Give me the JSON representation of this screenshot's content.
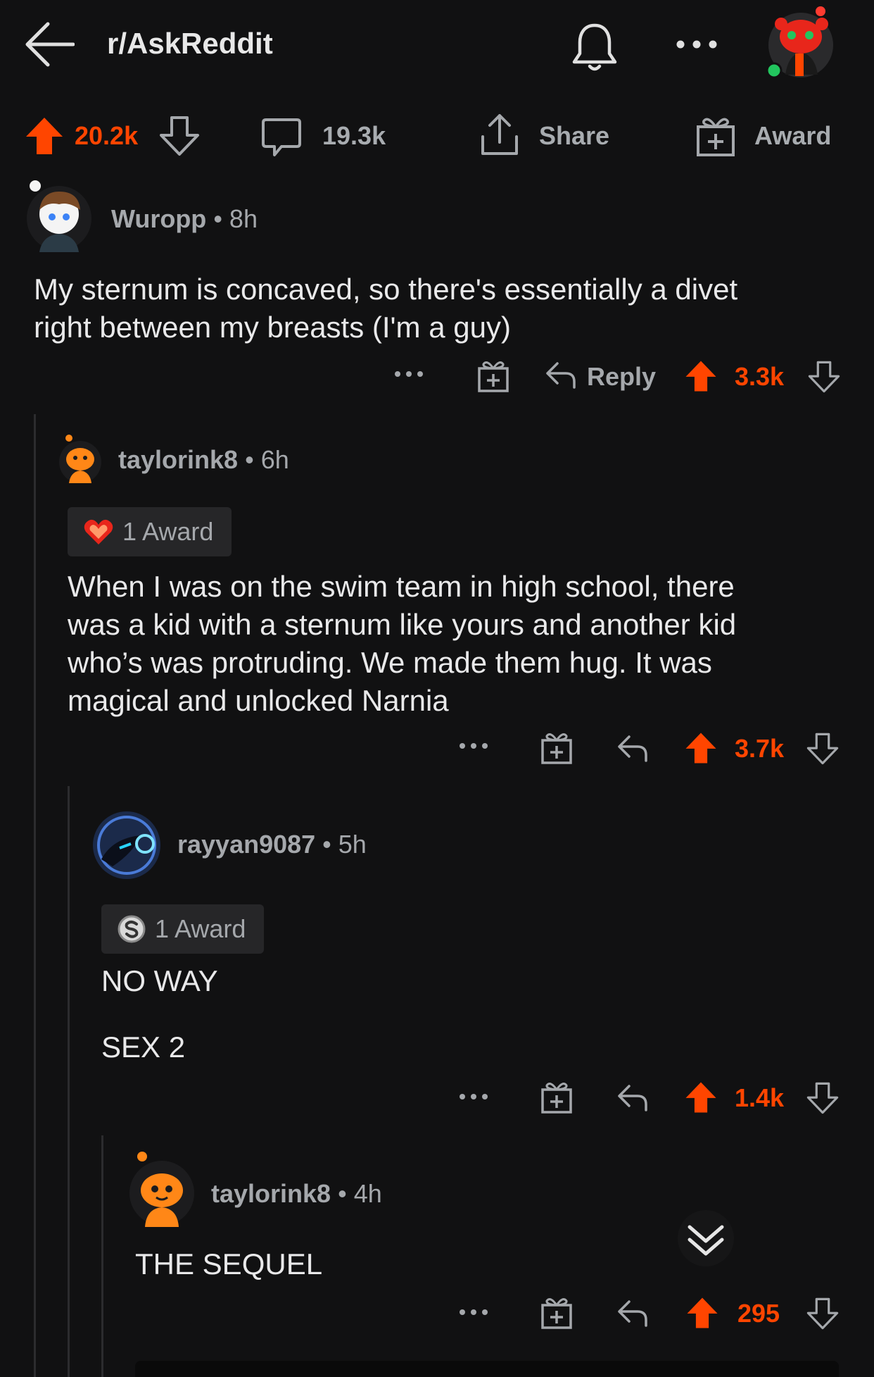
{
  "header": {
    "subreddit": "r/AskReddit"
  },
  "post_actions": {
    "upvotes": "20.2k",
    "comments": "19.3k",
    "share_label": "Share",
    "award_label": "Award"
  },
  "comments": [
    {
      "user": "Wuropp",
      "time": "8h",
      "text_lines": [
        "My sternum is concaved, so there's essentially a divet",
        "right between my breasts (I'm a guy)"
      ],
      "reply_label": "Reply",
      "score": "3.3k"
    },
    {
      "user": "taylorink8",
      "time": "6h",
      "award": "1 Award",
      "text_lines": [
        "When I was on the swim team in high school, there",
        "was a kid with a sternum like yours and another kid",
        "who’s was protruding. We made them hug. It was",
        "magical and unlocked Narnia"
      ],
      "score": "3.7k"
    },
    {
      "user": "rayyan9087",
      "time": "5h",
      "award": "1 Award",
      "text_lines": [
        "NO WAY",
        "SEX 2"
      ],
      "score": "1.4k"
    },
    {
      "user": "taylorink8",
      "time": "4h",
      "text_lines": [
        "THE SEQUEL"
      ],
      "score": "295"
    }
  ],
  "colors": {
    "accent": "#ff4500",
    "background": "#111112",
    "muted": "#a5a8ac"
  },
  "icons": [
    "back-arrow-icon",
    "bell-icon",
    "more-icon",
    "avatar",
    "upvote-icon",
    "downvote-icon",
    "comment-icon",
    "share-icon",
    "gift-icon",
    "reply-icon",
    "collapse-chevron-icon"
  ]
}
